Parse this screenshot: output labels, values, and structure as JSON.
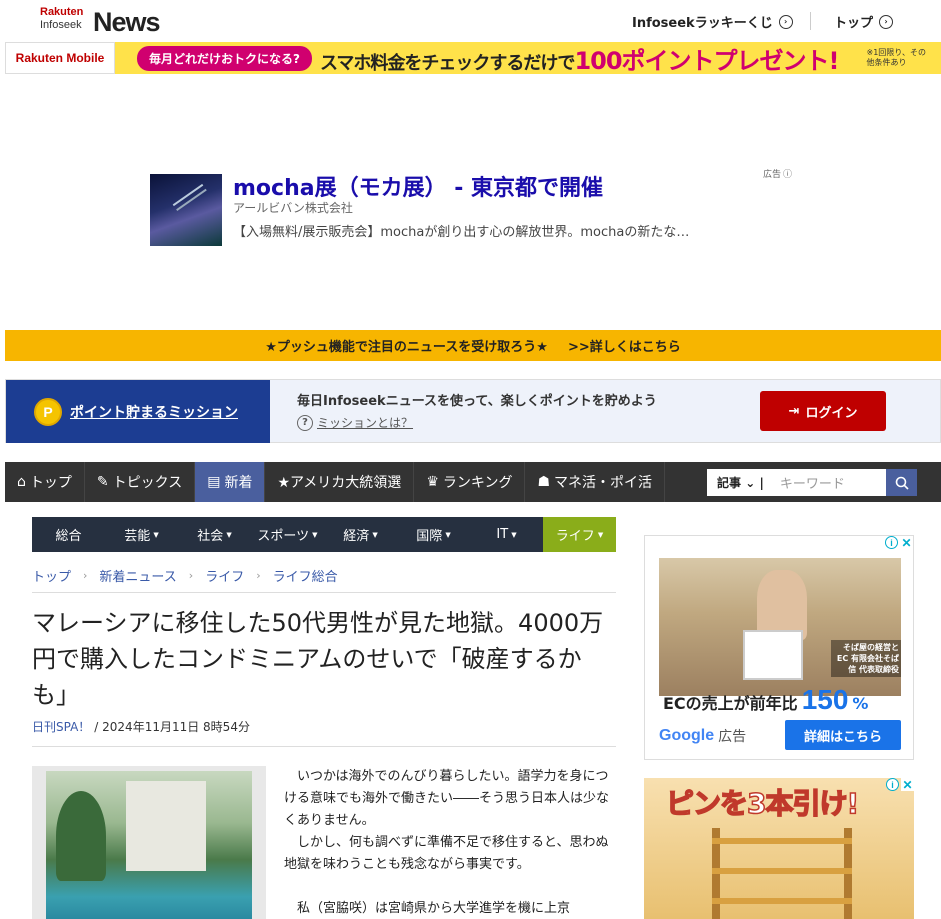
{
  "header": {
    "logo_rakuten": "Rakuten",
    "logo_infoseek": "Infoseek",
    "logo_news": "News",
    "link_lucky": "Infoseekラッキーくじ",
    "link_top": "トップ"
  },
  "mobile_banner": {
    "brand": "Rakuten Mobile",
    "pill": "毎月どれだけおトクになる?",
    "main_a": "スマホ料金をチェックするだけで",
    "main_b": "100ポイントプレゼント!",
    "note": "※1回限り、その他条件あり"
  },
  "ad": {
    "title": "mocha展（モカ展） - 東京都で開催",
    "advertiser": "アールビバン株式会社",
    "description": "【入場無料/展示販売会】mochaが創り出す心の解放世界。mochaの新たな…",
    "label": "広告"
  },
  "push": {
    "text": "★プッシュ機能で注目のニュースを受け取ろう★",
    "link": ">>詳しくはこちら"
  },
  "mission": {
    "title": "ポイント貯まるミッション",
    "text": "毎日Infoseekニュースを使って、楽しくポイントを貯めよう",
    "what": "ミッションとは？",
    "login": "ログイン"
  },
  "main_nav": [
    {
      "label": "トップ",
      "icon": "home-icon"
    },
    {
      "label": "トピックス",
      "icon": "pencil-icon"
    },
    {
      "label": "新着",
      "icon": "document-icon"
    },
    {
      "label": "★アメリカ大統領選",
      "icon": ""
    },
    {
      "label": "ランキング",
      "icon": "crown-icon"
    },
    {
      "label": "マネ活・ポイ活",
      "icon": "money-bag-icon"
    }
  ],
  "search": {
    "category": "記事",
    "placeholder": "キーワード"
  },
  "sub_nav": [
    {
      "label": "総合",
      "arrow": ""
    },
    {
      "label": "芸能",
      "arrow": "▼"
    },
    {
      "label": "社会",
      "arrow": "▼"
    },
    {
      "label": "スポーツ",
      "arrow": "▼"
    },
    {
      "label": "経済",
      "arrow": "▼"
    },
    {
      "label": "国際",
      "arrow": "▼"
    },
    {
      "label": "IT",
      "arrow": "▼"
    },
    {
      "label": "ライフ",
      "arrow": "▼"
    }
  ],
  "breadcrumb": [
    "トップ",
    "新着ニュース",
    "ライフ",
    "ライフ総合"
  ],
  "article": {
    "title": "マレーシアに移住した50代男性が見た地獄。4000万円で購入したコンドミニアムのせいで「破産するかも」",
    "source": "日刊SPA！",
    "date": "/ 2024年11月11日 8時54分",
    "p1": "いつかは海外でのんびり暮らしたい。語学力を身につける意味でも海外で働きたい――そう思う日本人は少なくありません。",
    "p2": "しかし、何も調べずに準備不足で移住すると、思わぬ地獄を味わうことも残念ながら事実です。",
    "p3": "私（宮脇咲）は宮崎県から大学進学を機に上京"
  },
  "right_ad1": {
    "image_text": "そば屋の経営とEC 有限会社そば信 代表取締役",
    "headline": "ECの売上が前年比",
    "percent": "150",
    "percent_sign": "%",
    "google": "Google",
    "ad_label": "広告",
    "button": "詳細はこちら"
  },
  "right_ad2": {
    "title": "ピンを3本引け!"
  },
  "colors": {
    "brand_red": "#bf0000",
    "nav_active": "#4a5f9e",
    "subnav_active": "#8aad1a",
    "push_bar": "#f7b500",
    "mission_blue": "#1c3d92"
  }
}
